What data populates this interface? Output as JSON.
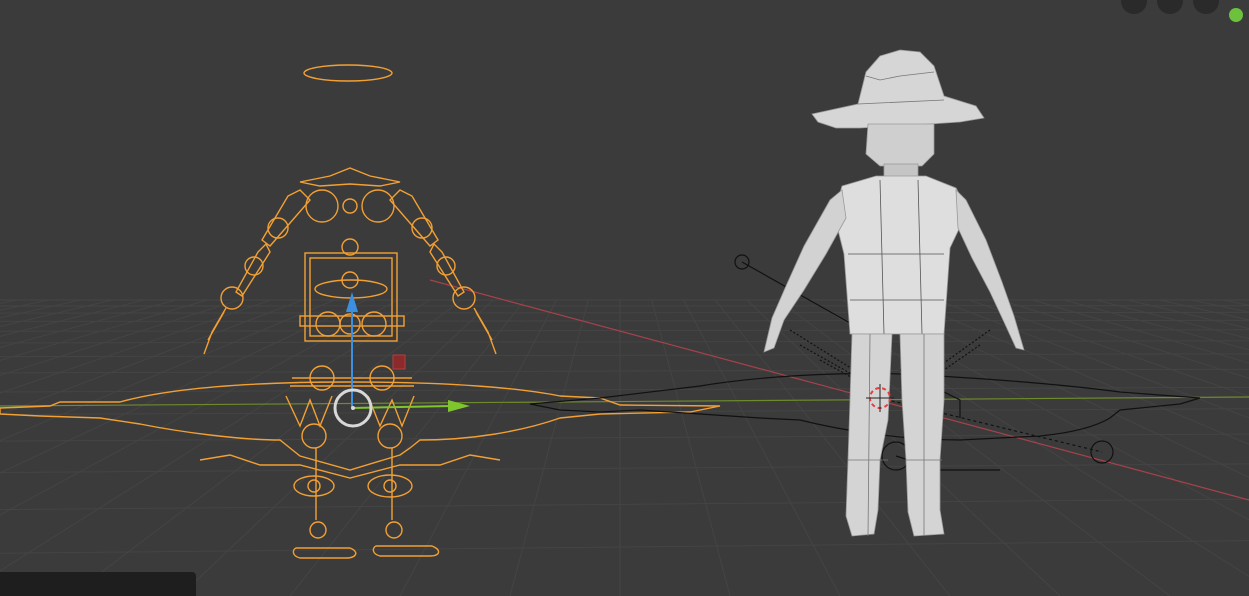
{
  "viewport": {
    "mode": "pose",
    "background": "#3b3b3b",
    "grid_color": "#444444",
    "x_axis_color": "#a6424c",
    "y_axis_color": "#7fa12d",
    "selection_color": "#f3a033",
    "mesh_color": "#dcdcdc"
  },
  "gizmo": {
    "x_handle_color": "#7fc52e",
    "z_handle_color": "#3d8fe0",
    "center_color": "#d8d8d8"
  },
  "objects": [
    {
      "name_icon": "armature-icon",
      "state": "selected"
    },
    {
      "name_icon": "character-mesh-icon",
      "state": "unselected"
    }
  ],
  "header": {
    "icons": [
      "navigation-icon",
      "navigation-icon",
      "navigation-icon",
      "active-indicator-icon"
    ]
  }
}
